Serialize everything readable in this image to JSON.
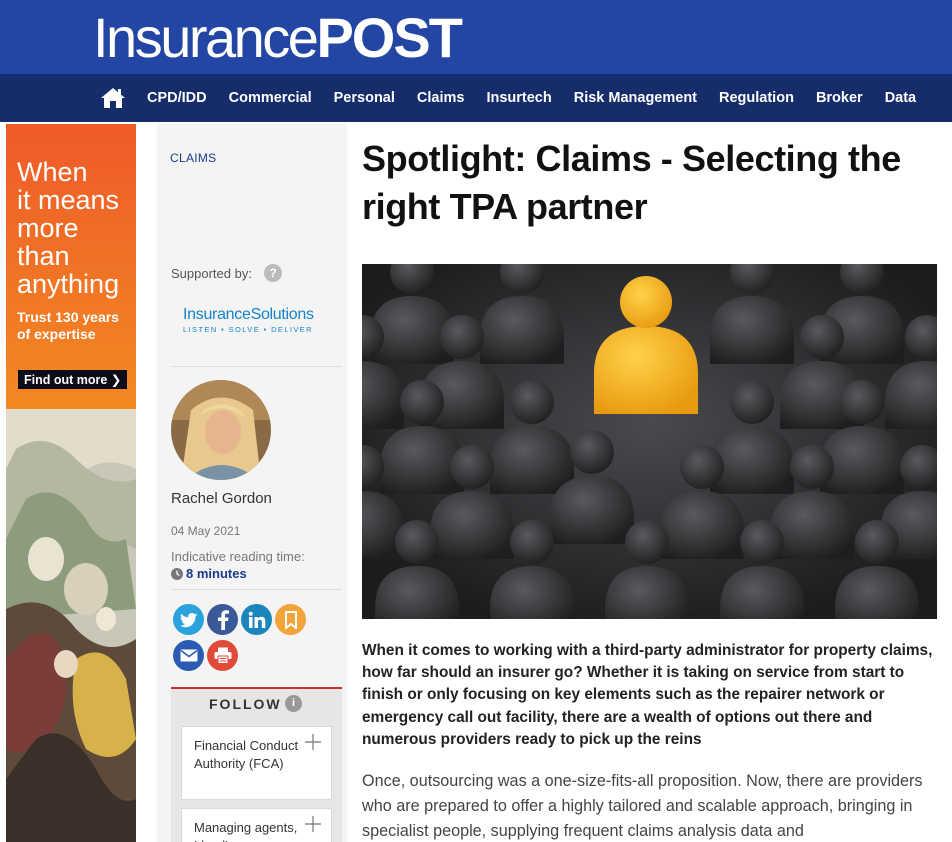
{
  "header": {
    "logo_light": "Insurance",
    "logo_bold": "POST",
    "brand_color": "#2346a5",
    "nav_color": "#172d6b"
  },
  "nav": {
    "home_icon": "home-icon",
    "items": [
      "CPD/IDD",
      "Commercial",
      "Personal",
      "Claims",
      "Insurtech",
      "Risk Management",
      "Regulation",
      "Broker",
      "Data"
    ]
  },
  "ad": {
    "headline_lines": [
      "When",
      "it means",
      "more",
      "than",
      "anything"
    ],
    "sub_lines": [
      "Trust 130 years",
      "of expertise"
    ],
    "cta": "Find out more"
  },
  "sidebar": {
    "section": "CLAIMS",
    "supported_by": "Supported by:",
    "help_icon": "?",
    "sponsor": {
      "name": "InsuranceSolutions",
      "tagline": "LISTEN • SOLVE • DELIVER"
    },
    "author": "Rachel Gordon",
    "date": "04 May 2021",
    "reading_time_label": "Indicative reading time:",
    "reading_time_value": "8 minutes",
    "share_icons": [
      "twitter-icon",
      "facebook-icon",
      "linkedin-icon",
      "bookmark-icon",
      "email-icon",
      "print-icon"
    ],
    "follow": {
      "title": "FOLLOW",
      "info_icon": "i",
      "items": [
        "Financial Conduct Authority (FCA)",
        "Managing agents, Lloyd's"
      ]
    }
  },
  "article": {
    "headline": "Spotlight: Claims - Selecting the right TPA partner",
    "standfirst": "When it comes to working with a third-party administrator for property claims, how far should an insurer go? Whether it is taking on service from start to finish or only focusing on key elements such as the repairer network or emergency call out facility, there are a wealth of options out there and numerous providers ready to pick up the reins",
    "body": "Once, outsourcing was a one-size-fits-all proposition. Now, there are providers who are prepared to offer a highly tailored and scalable approach, bringing in specialist people, supplying frequent claims analysis data and"
  }
}
